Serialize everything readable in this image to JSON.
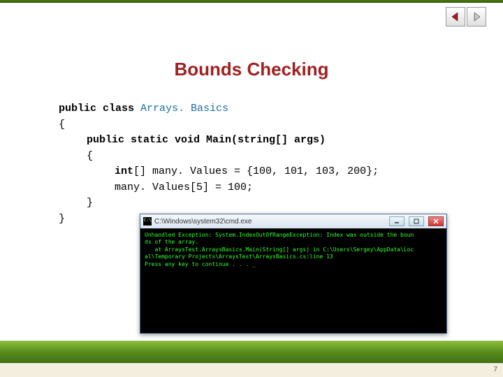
{
  "title": "Bounds Checking",
  "page_number": "7",
  "nav": {
    "prev_icon": "triangle-left-icon",
    "next_icon": "triangle-right-icon"
  },
  "code": {
    "l1_pre": "public class ",
    "l1_cls": "Arrays. Basics",
    "l2": "{",
    "l3": "public static void Main(string[] args)",
    "l4": "{",
    "l5_pre": "int",
    "l5_post": "[] many. Values = {100, 101, 103, 200};",
    "l6": "many. Values[5] = 100;",
    "l7": "}",
    "l8": "}"
  },
  "console": {
    "title_path": "C:\\Windows\\system32\\cmd.exe",
    "line1": "Unhandled Exception: System.IndexOutOfRangeException: Index was outside the boun",
    "line2": "ds of the array.",
    "line3": "   at ArraysTest.ArraysBasics.Main(String[] args) in C:\\Users\\Sergey\\AppData\\Loc",
    "line4": "al\\Temporary Projects\\ArraysTest\\ArraysBasics.cs:line 13",
    "line5": "Press any key to continue . . . _"
  }
}
